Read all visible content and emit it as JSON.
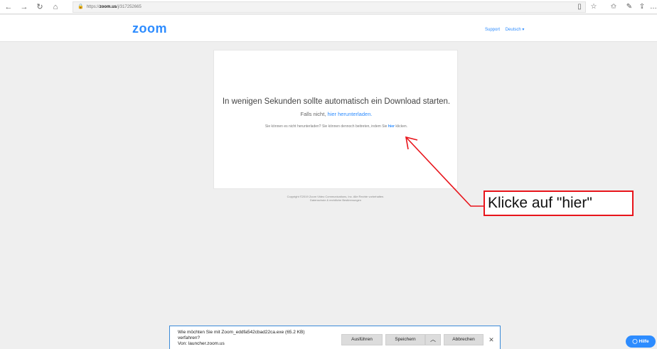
{
  "browser": {
    "url_scheme": "https://",
    "url_domain": "zoom.us",
    "url_path": "/j/317252665",
    "icons": [
      "back-icon",
      "forward-icon",
      "refresh-icon",
      "home-icon",
      "lock-icon",
      "reading-view-icon",
      "favorite-star-icon",
      "favorites-icon",
      "pen-icon",
      "share-icon",
      "more-icon"
    ]
  },
  "header": {
    "logo": "zoom",
    "support": "Support",
    "language": "Deutsch ▾"
  },
  "card": {
    "headline": "In wenigen Sekunden sollte automatisch ein Download starten.",
    "sub_prefix": "Falls nicht, ",
    "sub_link": "hier herunterladen.",
    "hint_prefix": "Sie können es nicht herunterladen? Sie können dennoch beitreten, indem Sie ",
    "hint_link": "hier",
    "hint_suffix": " klicken."
  },
  "footer": {
    "copyright": "Copyright ©2019 Zoom Video Communications, Inc. Alle Rechte vorbehalten.",
    "legal": "Datenschutz & rechtliche Bestimmungen"
  },
  "annotation": {
    "text": "Klicke auf \"hier\"",
    "color": "#e8141b"
  },
  "download": {
    "line1": "Wie möchten Sie mit Zoom_eddfa542cbad22ca.exe (65.2 KB)",
    "line2": "verfahren?",
    "line3": "Von: launcher.zoom.us",
    "run": "Ausführen",
    "save": "Speichern",
    "cancel": "Abbrechen",
    "accent": "#3a8ad8"
  },
  "help": {
    "label": "Hilfe",
    "color": "#2d8cff"
  }
}
